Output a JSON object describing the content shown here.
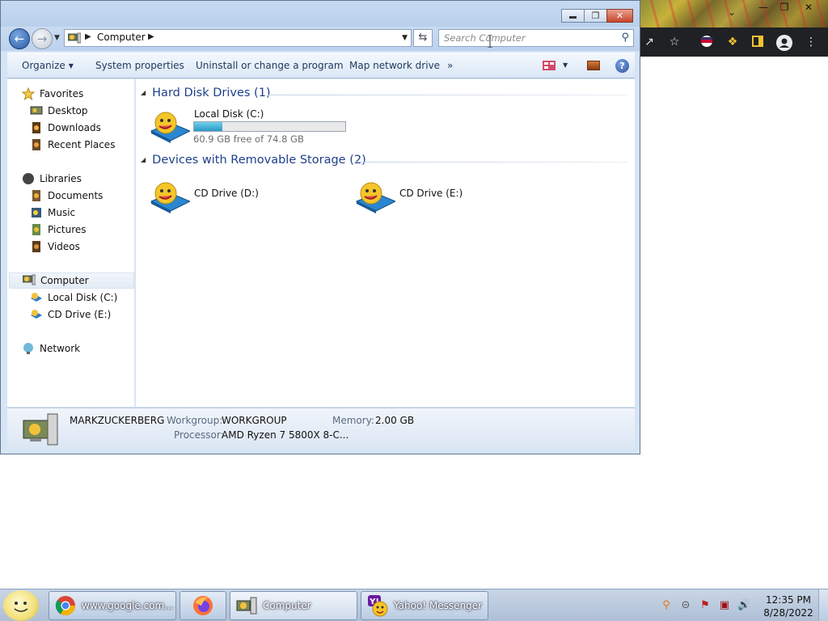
{
  "explorer": {
    "address": {
      "crumb": "Computer"
    },
    "search": {
      "placeholder": "Search Computer"
    },
    "commands": {
      "organize": "Organize",
      "system_properties": "System properties",
      "uninstall": "Uninstall or change a program",
      "map_drive": "Map network drive",
      "more": "»"
    },
    "nav": {
      "favorites": "Favorites",
      "desktop": "Desktop",
      "downloads": "Downloads",
      "recent_places": "Recent Places",
      "libraries": "Libraries",
      "documents": "Documents",
      "music": "Music",
      "pictures": "Pictures",
      "videos": "Videos",
      "computer": "Computer",
      "local_disk": "Local Disk (C:)",
      "cd_drive_e": "CD Drive (E:)",
      "network": "Network"
    },
    "groups": {
      "hdd": "Hard Disk Drives (1)",
      "removable": "Devices with Removable Storage (2)"
    },
    "drives": {
      "c": {
        "name": "Local Disk (C:)",
        "free_text": "60.9 GB free of 74.8 GB",
        "used_fraction": 0.186
      },
      "d": {
        "name": "CD Drive (D:)"
      },
      "e": {
        "name": "CD Drive (E:)"
      }
    },
    "details": {
      "computer_name": "MARKZUCKERBERG",
      "workgroup_label": "Workgroup:",
      "workgroup_value": "WORKGROUP",
      "memory_label": "Memory:",
      "memory_value": "2.00 GB",
      "processor_label": "Processor:",
      "processor_value": "AMD Ryzen 7 5800X 8-C..."
    }
  },
  "taskbar": {
    "buttons": [
      {
        "label": "www.google.com..."
      },
      {
        "label": ""
      },
      {
        "label": "Computer"
      },
      {
        "label": "Yahoo! Messenger"
      }
    ],
    "clock": {
      "time": "12:35 PM",
      "date": "8/28/2022"
    }
  },
  "colors": {
    "link_blue": "#1e395b",
    "group_blue": "#1e3f8a",
    "progress": "#2a9ac6"
  }
}
